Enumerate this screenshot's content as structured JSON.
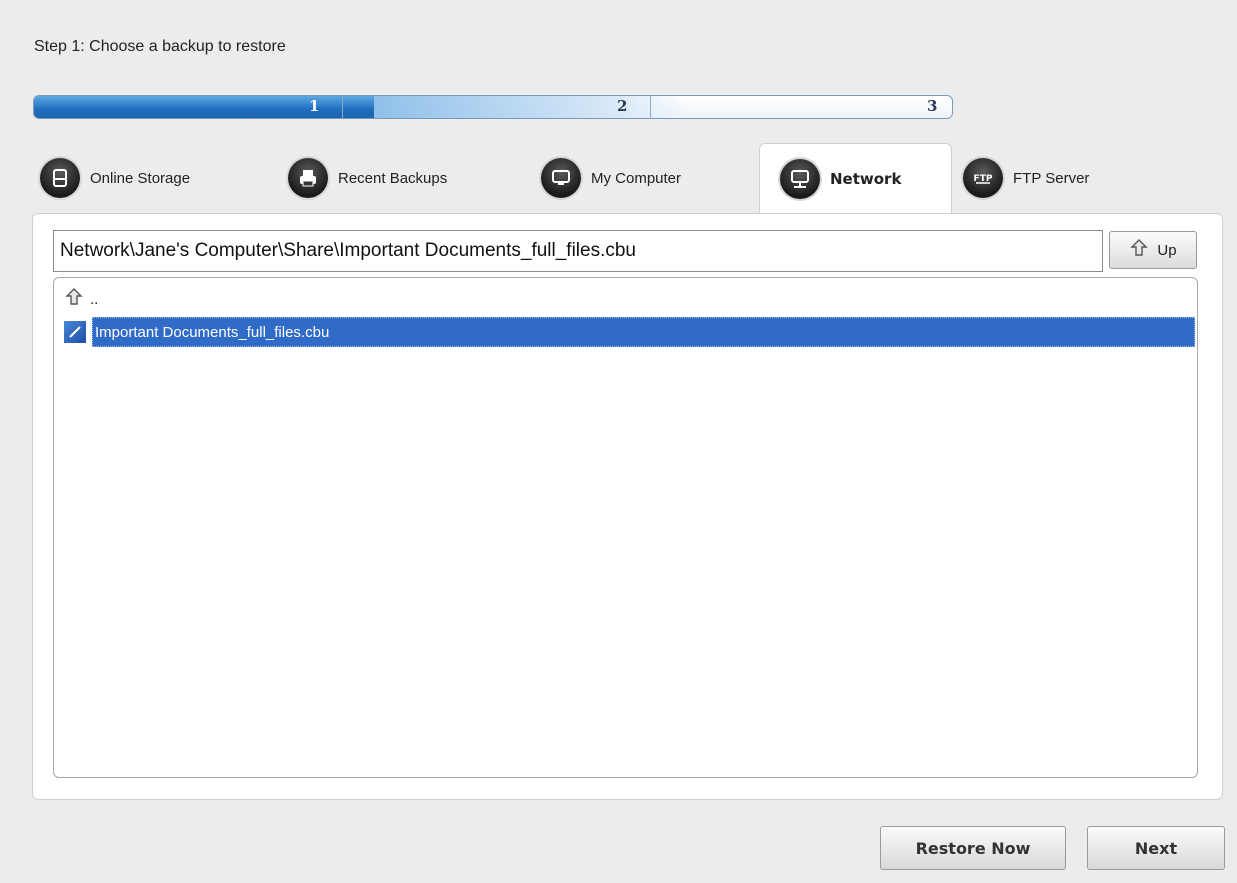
{
  "step": {
    "title": "Step 1: Choose a backup to restore"
  },
  "progress": {
    "steps": [
      "1",
      "2",
      "3"
    ],
    "current": 1
  },
  "tabs": [
    {
      "label": "Online Storage",
      "icon": "hard-drive-icon"
    },
    {
      "label": "Recent Backups",
      "icon": "printer-icon"
    },
    {
      "label": "My Computer",
      "icon": "monitor-icon"
    },
    {
      "label": "Network",
      "icon": "network-monitor-icon"
    },
    {
      "label": "FTP Server",
      "icon": "ftp-icon"
    }
  ],
  "selected_tab": "Network",
  "path": {
    "value": "Network\\Jane's Computer\\Share\\Important Documents_full_files.cbu"
  },
  "up_button": {
    "label": "Up"
  },
  "file_list": {
    "items": [
      {
        "label": "..",
        "icon": "parent-folder-icon"
      },
      {
        "label": "Important Documents_full_files.cbu",
        "icon": "backup-file-icon",
        "selected": true
      }
    ]
  },
  "footer": {
    "restore_label": "Restore Now",
    "next_label": "Next"
  },
  "colors": {
    "accent": "#1f6fbf",
    "selection": "#2f6bc7"
  }
}
